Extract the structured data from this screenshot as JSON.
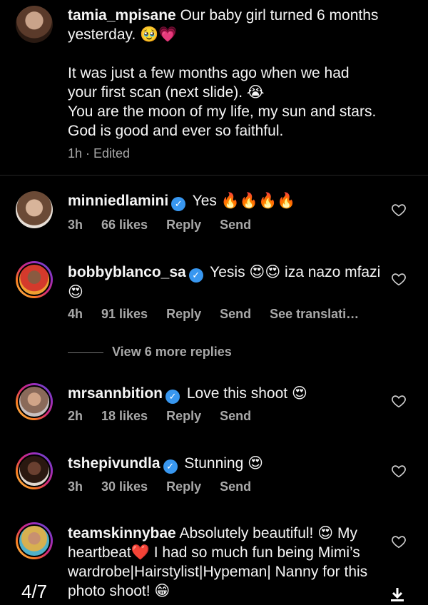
{
  "caption": {
    "username": "tamia_mpisane",
    "line1": "Our baby girl turned 6 months yesterday. 🥹💗",
    "para2": "It was just a few months ago when we had your first scan (next slide). 😭",
    "para3": "You are the moon of my life, my sun and stars. God is good and ever so faithful.",
    "meta": "1h · Edited"
  },
  "comments": [
    {
      "username": "minniedlamini",
      "text": "Yes 🔥🔥🔥🔥",
      "time": "3h",
      "likes": "66 likes",
      "reply": "Reply",
      "send": "Send"
    },
    {
      "username": "bobbyblanco_sa",
      "text": "Yesis 😍😍 iza nazo mfazi 😍",
      "time": "4h",
      "likes": "91 likes",
      "reply": "Reply",
      "send": "Send",
      "translate": "See translati…"
    },
    {
      "username": "mrsannbition",
      "text": "Love this shoot 😍",
      "time": "2h",
      "likes": "18 likes",
      "reply": "Reply",
      "send": "Send"
    },
    {
      "username": "tshepivundla",
      "text": "Stunning 😍",
      "time": "3h",
      "likes": "30 likes",
      "reply": "Reply",
      "send": "Send"
    },
    {
      "username": "teamskinnybae",
      "text": "Absolutely beautiful! 😍 My heartbeat❤️ I had so much fun being Mimi’s wardrobe|Hairstylist|Hypeman| Nanny for this photo shoot! 😁"
    }
  ],
  "view_more": "View 6 more replies",
  "slide_counter": "4/7",
  "colors": {
    "verified": "#3897f0",
    "meta": "#a8a8a8",
    "background": "#000000"
  }
}
